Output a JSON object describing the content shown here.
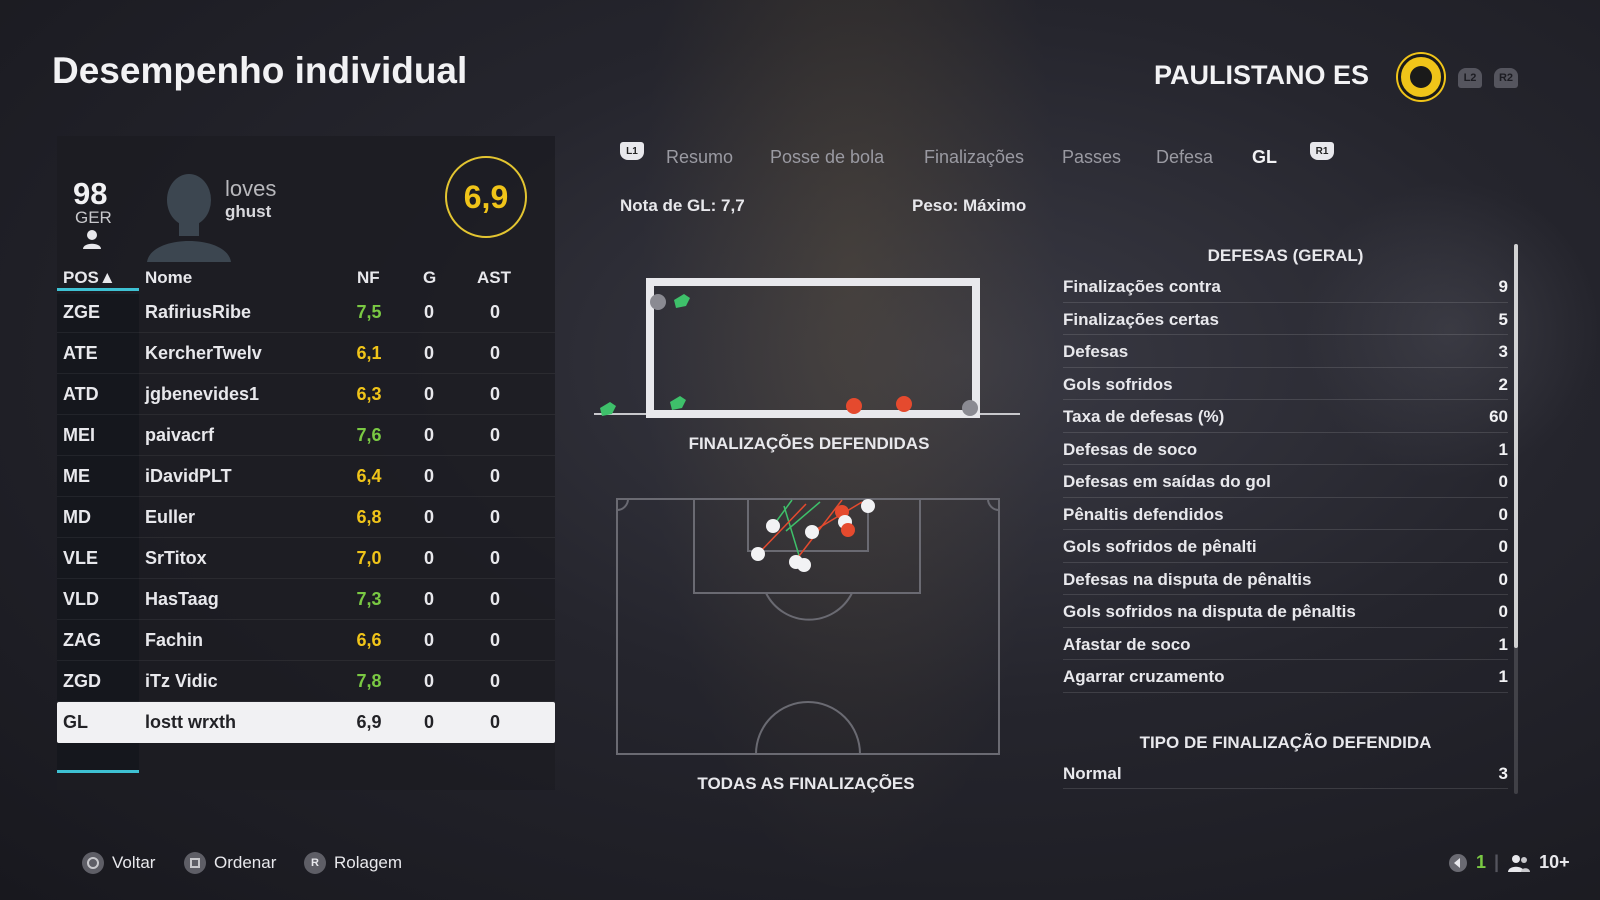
{
  "header": {
    "title": "Desempenho individual",
    "team_name": "PAULISTANO ES",
    "l2": "L2",
    "r2": "R2"
  },
  "player": {
    "ovr": "98",
    "ovr_pos": "GER",
    "name_line1": "loves",
    "name_line2": "ghust",
    "rating": "6,9"
  },
  "table": {
    "headers": {
      "pos": "POS▲",
      "name": "Nome",
      "nf": "NF",
      "g": "G",
      "ast": "AST"
    },
    "rows": [
      {
        "pos": "ZGE",
        "name": "RafiriusRibe",
        "nf": "7,5",
        "g": "0",
        "ast": "0",
        "nf_color": "green"
      },
      {
        "pos": "ATE",
        "name": "KercherTwelv",
        "nf": "6,1",
        "g": "0",
        "ast": "0",
        "nf_color": "yellow"
      },
      {
        "pos": "ATD",
        "name": "jgbenevides1",
        "nf": "6,3",
        "g": "0",
        "ast": "0",
        "nf_color": "yellow"
      },
      {
        "pos": "MEI",
        "name": "paivacrf",
        "nf": "7,6",
        "g": "0",
        "ast": "0",
        "nf_color": "green"
      },
      {
        "pos": "ME",
        "name": "iDavidPLT",
        "nf": "6,4",
        "g": "0",
        "ast": "0",
        "nf_color": "yellow"
      },
      {
        "pos": "MD",
        "name": "Euller",
        "nf": "6,8",
        "g": "0",
        "ast": "0",
        "nf_color": "yellow"
      },
      {
        "pos": "VLE",
        "name": "SrTitox",
        "nf": "7,0",
        "g": "0",
        "ast": "0",
        "nf_color": "yellow"
      },
      {
        "pos": "VLD",
        "name": "HasTaag",
        "nf": "7,3",
        "g": "0",
        "ast": "0",
        "nf_color": "green"
      },
      {
        "pos": "ZAG",
        "name": "Fachin",
        "nf": "6,6",
        "g": "0",
        "ast": "0",
        "nf_color": "yellow"
      },
      {
        "pos": "ZGD",
        "name": "iTz Vidic",
        "nf": "7,8",
        "g": "0",
        "ast": "0",
        "nf_color": "green"
      },
      {
        "pos": "GL",
        "name": "lostt wrxth",
        "nf": "6,9",
        "g": "0",
        "ast": "0",
        "nf_color": "dark"
      }
    ]
  },
  "tabs": {
    "l1": "L1",
    "r1": "R1",
    "items": [
      "Resumo",
      "Posse de bola",
      "Finalizações",
      "Passes",
      "Defesa",
      "GL"
    ],
    "active": "GL"
  },
  "goalkeeper": {
    "nota": "Nota de GL: 7,7",
    "peso": "Peso: Máximo",
    "caption_saved": "FINALIZAÇÕES DEFENDIDAS",
    "caption_all": "TODAS AS FINALIZAÇÕES"
  },
  "stats": {
    "title": "DEFESAS (GERAL)",
    "rows": [
      {
        "label": "Finalizações contra",
        "value": "9"
      },
      {
        "label": "Finalizações certas",
        "value": "5"
      },
      {
        "label": "Defesas",
        "value": "3"
      },
      {
        "label": "Gols sofridos",
        "value": "2"
      },
      {
        "label": "Taxa de defesas (%)",
        "value": "60"
      },
      {
        "label": "Defesas de soco",
        "value": "1"
      },
      {
        "label": "Defesas em saídas do gol",
        "value": "0"
      },
      {
        "label": "Pênaltis defendidos",
        "value": "0"
      },
      {
        "label": "Gols sofridos de pênalti",
        "value": "0"
      },
      {
        "label": "Defesas na disputa de pênaltis",
        "value": "0"
      },
      {
        "label": "Gols sofridos na disputa de pênaltis",
        "value": "0"
      },
      {
        "label": "Afastar de soco",
        "value": "1"
      },
      {
        "label": "Agarrar cruzamento",
        "value": "1"
      }
    ],
    "title2": "TIPO DE FINALIZAÇÃO DEFENDIDA",
    "rows2": [
      {
        "label": "Normal",
        "value": "3"
      }
    ]
  },
  "footer": {
    "back": "Voltar",
    "sort": "Ordenar",
    "scroll": "Rolagem",
    "r_label": "R",
    "players_count": "1",
    "online_count": "10+"
  },
  "colors": {
    "green": "#7ac943",
    "yellow": "#f0c419",
    "accent": "#3ec1d3"
  }
}
